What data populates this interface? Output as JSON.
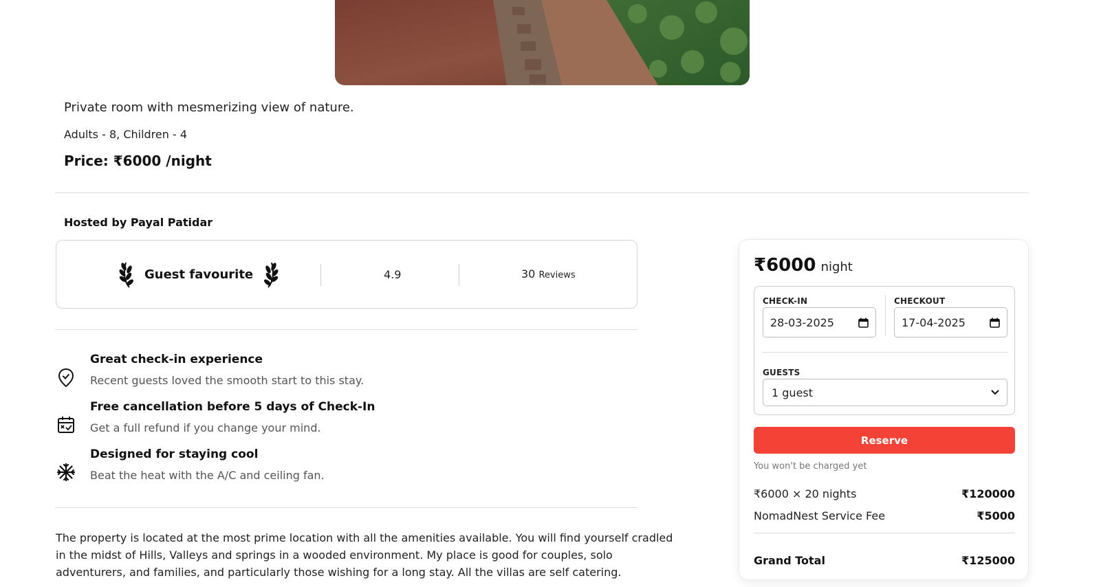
{
  "listing": {
    "title": "Private room with mesmerizing view of nature.",
    "occupancy": "Adults - 8, Children - 4",
    "price": "Price: ₹6000 /night"
  },
  "host": {
    "hosted_by": "Hosted by Payal Patidar"
  },
  "guest_card": {
    "badge_label": "Guest favourite",
    "rating": "4.9",
    "reviews_count": "30",
    "reviews_label": "Reviews"
  },
  "features": [
    {
      "icon": "location-check-icon",
      "title": "Great check-in experience",
      "description": "Recent guests loved the smooth start to this stay."
    },
    {
      "icon": "calendar-check-icon",
      "title": "Free cancellation before 5 days of Check-In",
      "description": "Get a full refund if you change your mind."
    },
    {
      "icon": "snowflake-icon",
      "title": "Designed for staying cool",
      "description": "Beat the heat with the A/C and ceiling fan."
    }
  ],
  "description": "The property is located at the most prime location with all the amenities available. You will find yourself cradled in the midst of Hills, Valleys and springs in a wooded environment. My place is good for couples, solo adventurers, and families, and particularly those wishing for a long stay. All the villas are self catering.",
  "booking": {
    "price_amount": "₹6000",
    "price_unit": "night",
    "checkin_label": "CHECK-IN",
    "checkin_value": "28-03-2025",
    "checkout_label": "CHECKOUT",
    "checkout_value": "17-04-2025",
    "guests_label": "GUESTS",
    "guests_value": "1 guest",
    "reserve_label": "Reserve",
    "note": "You won't be charged yet",
    "nights_line": "₹6000 × 20 nights",
    "nights_amount": "₹120000",
    "fee_label": "NomadNest Service Fee",
    "fee_amount": "₹5000",
    "total_label": "Grand Total",
    "total_amount": "₹125000"
  },
  "colors": {
    "accent": "#f44336",
    "divider": "#dddddd",
    "muted_text": "#555555"
  }
}
